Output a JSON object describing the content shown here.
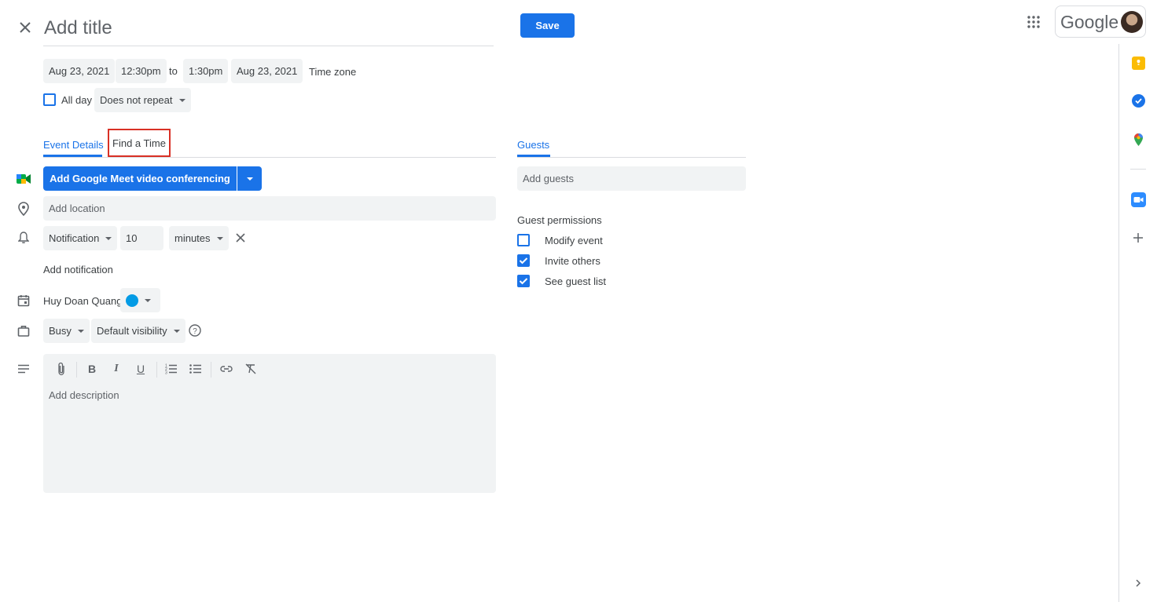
{
  "header": {
    "close_icon": "close-icon",
    "title_placeholder": "Add title",
    "save_label": "Save",
    "apps_icon": "apps-grid-icon",
    "brand": "Google"
  },
  "datetime": {
    "start_date": "Aug 23, 2021",
    "start_time": "12:30pm",
    "to_label": "to",
    "end_time": "1:30pm",
    "end_date": "Aug 23, 2021",
    "timezone_label": "Time zone",
    "all_day_label": "All day",
    "all_day_checked": false,
    "repeat_value": "Does not repeat"
  },
  "tabs": {
    "event_details": "Event Details",
    "find_time": "Find a Time",
    "guests": "Guests"
  },
  "meet": {
    "button_label": "Add Google Meet video conferencing"
  },
  "location": {
    "placeholder": "Add location"
  },
  "notification": {
    "type": "Notification",
    "amount": "10",
    "unit": "minutes",
    "add_label": "Add notification"
  },
  "calendar": {
    "owner": "Huy Doan Quang",
    "color": "#039be5"
  },
  "availability": {
    "status": "Busy",
    "visibility": "Default visibility"
  },
  "description": {
    "placeholder": "Add description"
  },
  "guests": {
    "add_placeholder": "Add guests",
    "permissions_title": "Guest permissions",
    "permissions": [
      {
        "label": "Modify event",
        "checked": false
      },
      {
        "label": "Invite others",
        "checked": true
      },
      {
        "label": "See guest list",
        "checked": true
      }
    ]
  },
  "colors": {
    "accent": "#1a73e8",
    "highlight_box": "#d93025"
  }
}
